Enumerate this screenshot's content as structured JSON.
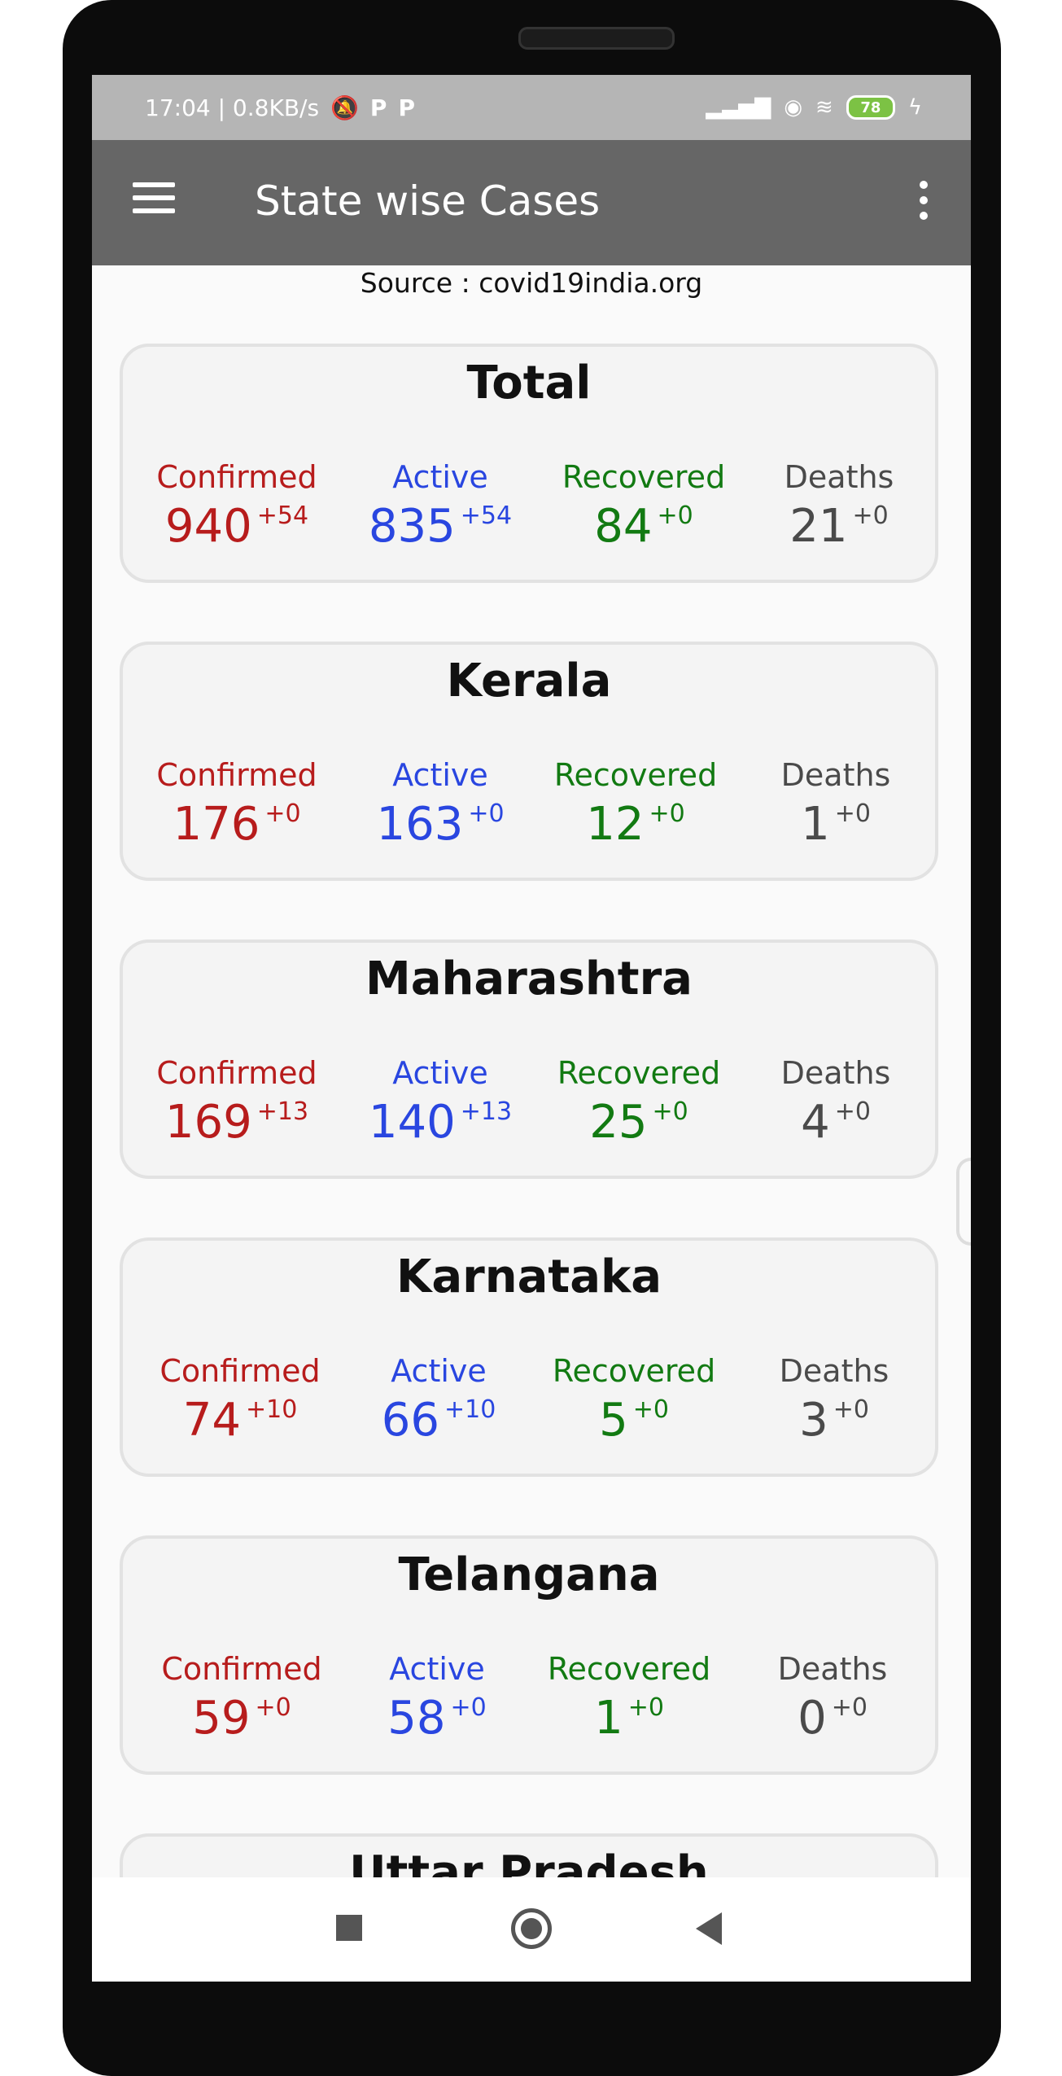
{
  "status_bar": {
    "time_speed": "17:04 | 0.8KB/s",
    "battery": "78",
    "p_label_1": "P",
    "p_label_2": "P"
  },
  "app_bar": {
    "title": "State wise Cases"
  },
  "source": "Source : covid19india.org",
  "labels": {
    "confirmed": "Confirmed",
    "active": "Active",
    "recovered": "Recovered",
    "deaths": "Deaths"
  },
  "cards": [
    {
      "title": "Total",
      "confirmed": "940",
      "confirmed_delta": "+54",
      "active": "835",
      "active_delta": "+54",
      "recovered": "84",
      "recovered_delta": "+0",
      "deaths": "21",
      "deaths_delta": "+0"
    },
    {
      "title": "Kerala",
      "confirmed": "176",
      "confirmed_delta": "+0",
      "active": "163",
      "active_delta": "+0",
      "recovered": "12",
      "recovered_delta": "+0",
      "deaths": "1",
      "deaths_delta": "+0"
    },
    {
      "title": "Maharashtra",
      "confirmed": "169",
      "confirmed_delta": "+13",
      "active": "140",
      "active_delta": "+13",
      "recovered": "25",
      "recovered_delta": "+0",
      "deaths": "4",
      "deaths_delta": "+0"
    },
    {
      "title": "Karnataka",
      "confirmed": "74",
      "confirmed_delta": "+10",
      "active": "66",
      "active_delta": "+10",
      "recovered": "5",
      "recovered_delta": "+0",
      "deaths": "3",
      "deaths_delta": "+0"
    },
    {
      "title": "Telangana",
      "confirmed": "59",
      "confirmed_delta": "+0",
      "active": "58",
      "active_delta": "+0",
      "recovered": "1",
      "recovered_delta": "+0",
      "deaths": "0",
      "deaths_delta": "+0"
    },
    {
      "title": "Uttar Pradesh"
    }
  ],
  "colors": {
    "confirmed": "#b71c1c",
    "active": "#2946e0",
    "recovered": "#127a12",
    "deaths": "#4a4a4a",
    "app_bar": "#666666"
  },
  "icons": {
    "menu": "hamburger-menu-icon",
    "more": "more-vert-icon",
    "nav_recents": "square-icon",
    "nav_home": "circle-icon",
    "nav_back": "triangle-back-icon"
  }
}
